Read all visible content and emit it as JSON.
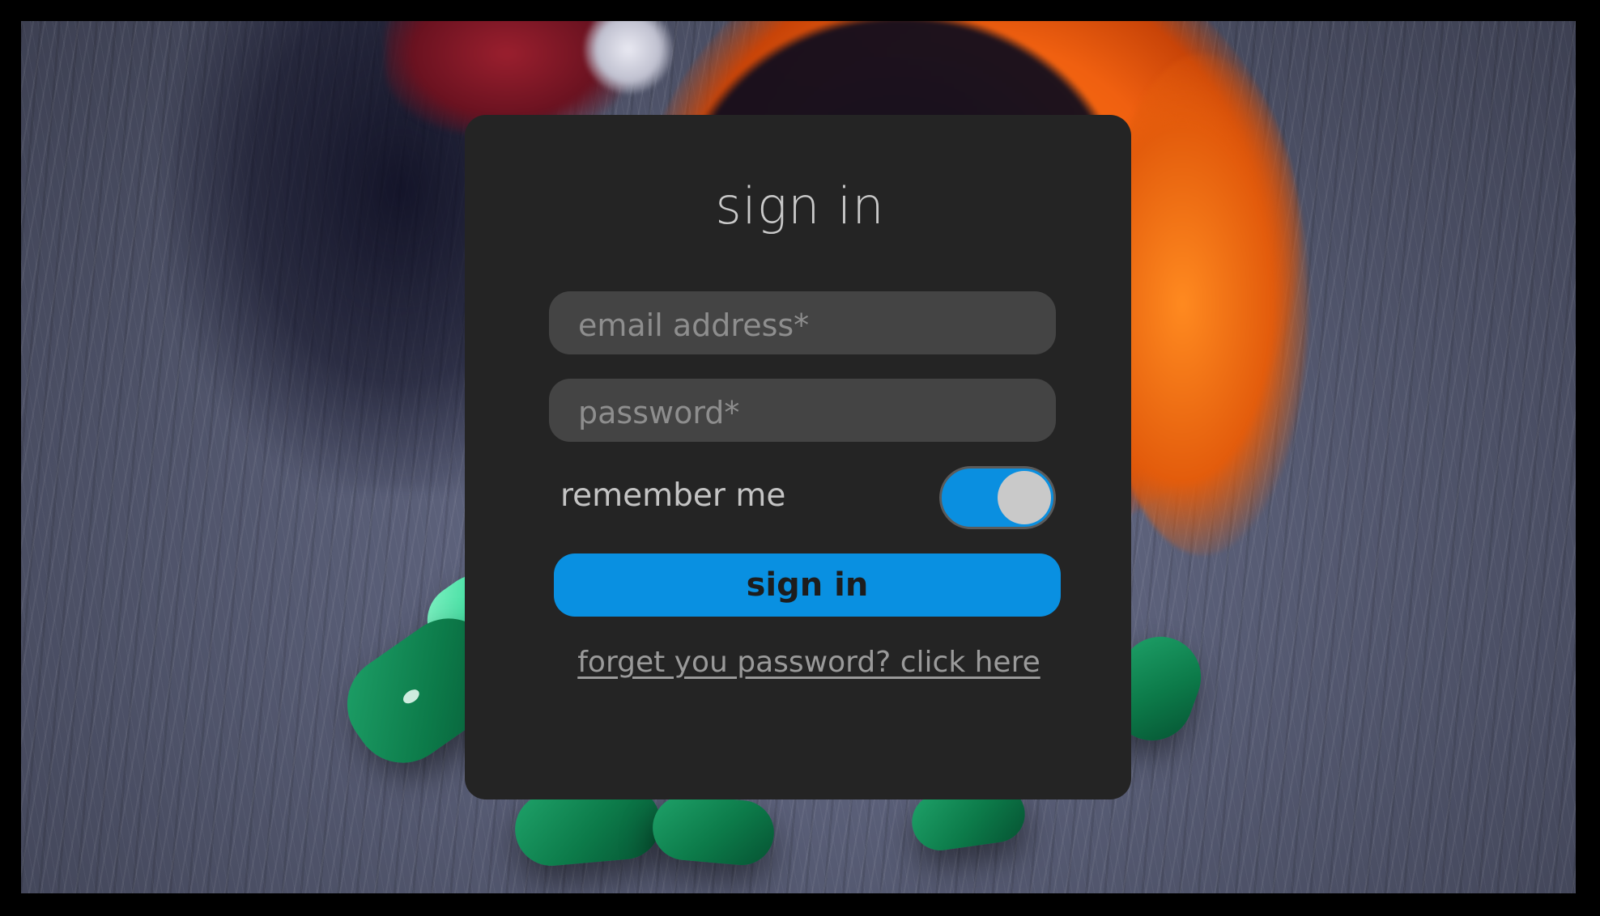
{
  "form": {
    "title": "sign in",
    "email_placeholder": "email address*",
    "password_placeholder": "password*",
    "remember_label": "remember me",
    "remember_checked": true,
    "submit_label": "sign in",
    "forgot_link": "forget you password? click here"
  },
  "colors": {
    "accent": "#0990e1",
    "card": "#242424",
    "input": "#444444"
  },
  "background": {
    "icons": [
      "pill-bottle-icon",
      "capsule-icon"
    ]
  }
}
